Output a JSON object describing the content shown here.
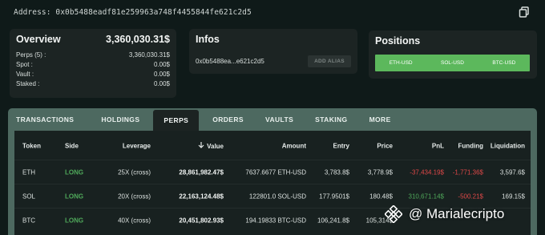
{
  "address_bar": {
    "text": "Address: 0x0b5488eadf81e259963a748f4455844fe621c2d5",
    "copy_icon": "copy-icon"
  },
  "overview": {
    "title": "Overview",
    "total": "3,360,030.31$",
    "rows": [
      {
        "label": "Perps (5) :",
        "value": "3,360,030.31$"
      },
      {
        "label": "Spot :",
        "value": "0.00$"
      },
      {
        "label": "Vault :",
        "value": "0.00$"
      },
      {
        "label": "Staked :",
        "value": "0.00$"
      }
    ]
  },
  "infos": {
    "title": "Infos",
    "address_short": "0x0b5488ea...e621c2d5",
    "add_alias_label": "ADD ALIAS"
  },
  "positions": {
    "title": "Positions",
    "segments": [
      "ETH-USD",
      "SOL-USD",
      "BTC-USD"
    ],
    "bar_color": "#5cb85c"
  },
  "tabs": [
    "TRANSACTIONS",
    "HOLDINGS",
    "PERPS",
    "ORDERS",
    "VAULTS",
    "STAKING",
    "MORE"
  ],
  "active_tab": "PERPS",
  "table": {
    "headers": {
      "token": "Token",
      "side": "Side",
      "leverage": "Leverage",
      "value": "Value",
      "amount": "Amount",
      "entry": "Entry",
      "price": "Price",
      "pnl": "PnL",
      "funding": "Funding",
      "liquidation": "Liquidation"
    },
    "sort_icon": "arrow-down-icon",
    "rows": [
      {
        "token": "ETH",
        "side": "LONG",
        "leverage": "25X (cross)",
        "value": "28,861,982.47$",
        "amount": "7637.6677 ETH-USD",
        "entry": "3,783.8$",
        "price": "3,778.9$",
        "pnl": "-37,434.19$",
        "funding": "-1,771.36$",
        "liquidation": "3,597.6$"
      },
      {
        "token": "SOL",
        "side": "LONG",
        "leverage": "20X (cross)",
        "value": "22,163,124.48$",
        "amount": "122801.0 SOL-USD",
        "entry": "177.9501$",
        "price": "180.48$",
        "pnl": "310,671.14$",
        "funding": "-500.21$",
        "liquidation": "169.15$"
      },
      {
        "token": "BTC",
        "side": "LONG",
        "leverage": "40X (cross)",
        "value": "20,451,802.93$",
        "amount": "194.19833 BTC-USD",
        "entry": "106,241.8$",
        "price": "105,314$",
        "pnl": "",
        "funding": "",
        "liquidation": ""
      }
    ],
    "colors": {
      "long": "#4fa85a",
      "negative": "#e04848",
      "positive": "#4fa85a"
    }
  },
  "watermark": {
    "text": "@ Marialecripto",
    "icon": "binance-logo-icon"
  }
}
